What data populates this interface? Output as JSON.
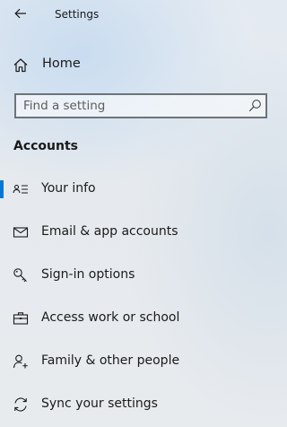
{
  "window": {
    "title": "Settings",
    "back_icon": "back-arrow-icon"
  },
  "home": {
    "label": "Home",
    "icon": "home-icon"
  },
  "search": {
    "placeholder": "Find a setting",
    "value": "",
    "icon": "search-icon"
  },
  "section": {
    "title": "Accounts"
  },
  "nav": {
    "accent_color": "#0078d7",
    "selected_index": 0,
    "items": [
      {
        "label": "Your info",
        "icon": "contact-card-icon"
      },
      {
        "label": "Email & app accounts",
        "icon": "mail-icon"
      },
      {
        "label": "Sign-in options",
        "icon": "key-icon"
      },
      {
        "label": "Access work or school",
        "icon": "briefcase-icon"
      },
      {
        "label": "Family & other people",
        "icon": "person-add-icon"
      },
      {
        "label": "Sync your settings",
        "icon": "sync-icon"
      }
    ]
  }
}
